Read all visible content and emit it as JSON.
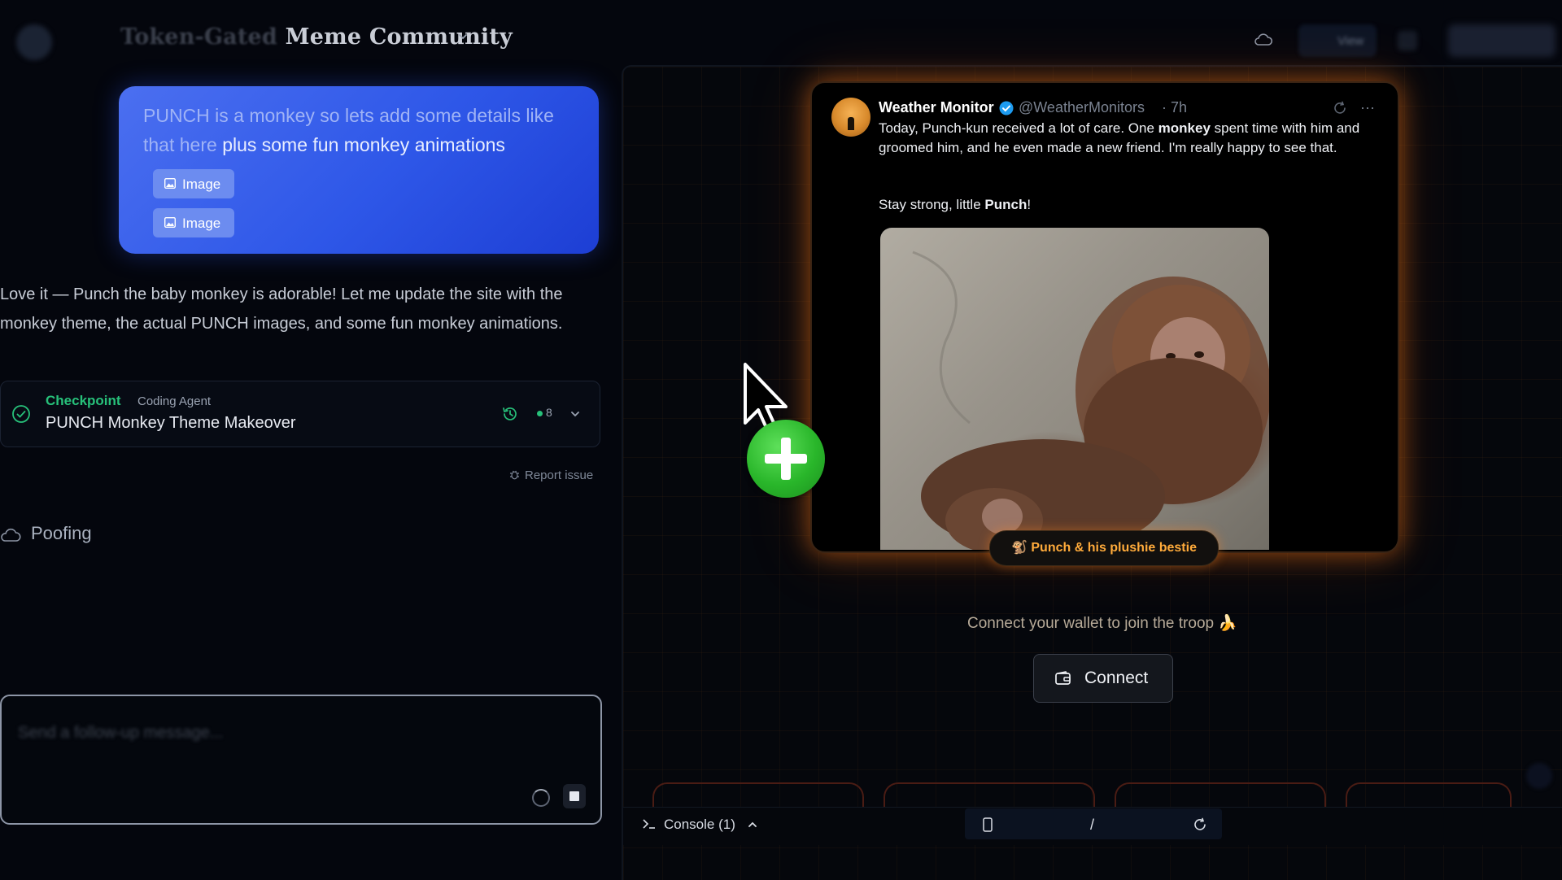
{
  "header": {
    "title_faded": "Token-Gated",
    "title": "Meme Community",
    "view_label": "View"
  },
  "chat": {
    "user_message_faded": "PUNCH is a monkey so lets add some details like that here",
    "user_message_rest": "plus some fun monkey animations",
    "attachments": [
      {
        "label": "Image",
        "icon": "image-icon"
      },
      {
        "label": "Image",
        "icon": "image-icon"
      }
    ],
    "assistant_message": "Love it — Punch the baby monkey is adorable! Let me update the site with the monkey theme, the actual PUNCH images, and some fun monkey animations.",
    "checkpoint": {
      "label": "Checkpoint",
      "agent": "Coding Agent",
      "title": "PUNCH Monkey Theme Makeover",
      "count": "8"
    },
    "report_issue": "Report issue",
    "status": "Poofing",
    "input_placeholder_faded": "Send a follow-up message...",
    "input_placeholder_visible": "follow-up message..."
  },
  "preview": {
    "tweet": {
      "name": "Weather Monitor",
      "handle": "@WeatherMonitors",
      "time": "· 7h",
      "more": "···",
      "text_part1": "Today, Punch-kun received a lot of care. One ",
      "text_bold1": "monkey",
      "text_part2": " spent time with him and groomed him, and he even made a new friend. I'm really happy to see that.",
      "text2_part1": "Stay strong, little ",
      "text2_bold": "Punch",
      "text2_end": "!",
      "photo_caption": "🐒 Punch & his plushie bestie"
    },
    "wallet_prompt": "Connect your wallet to join the troop 🍌",
    "connect_label": "Connect"
  },
  "console": {
    "label": "Console (1)",
    "path": "/"
  },
  "colors": {
    "accent_blue": "#2e57e8",
    "checkpoint_green": "#27c17a",
    "glow_orange": "#ff7a14",
    "caption_orange": "#ffab3b",
    "cursor_plus_green": "#29b62a"
  }
}
